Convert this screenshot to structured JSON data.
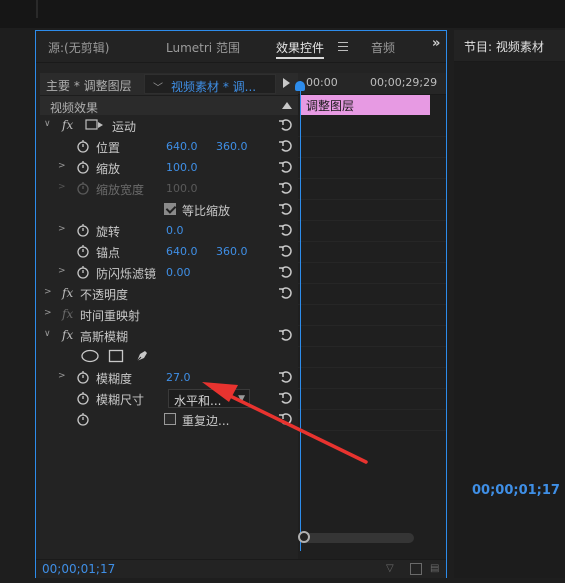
{
  "tabs": {
    "source": "源:(无剪辑)",
    "lumetri": "Lumetri 范围",
    "effect_controls": "效果控件",
    "audio": "音频",
    "program": "节目: 视频素材"
  },
  "header": {
    "master": "主要 * 调整图层",
    "clip_select": "视频素材 * 调...",
    "section": "视频效果"
  },
  "timeline": {
    "tc_start": "00:00",
    "tc_end": "00;00;29;29",
    "clip_label": "调整图层"
  },
  "effects": {
    "motion": {
      "name": "运动"
    },
    "position": {
      "name": "位置",
      "x": "640.0",
      "y": "360.0"
    },
    "scale": {
      "name": "缩放",
      "value": "100.0"
    },
    "scale_width": {
      "name": "缩放宽度",
      "value": "100.0"
    },
    "uniform_scale": {
      "name": "等比缩放"
    },
    "rotation": {
      "name": "旋转",
      "value": "0.0"
    },
    "anchor": {
      "name": "锚点",
      "x": "640.0",
      "y": "360.0"
    },
    "anti_flicker": {
      "name": "防闪烁滤镜",
      "value": "0.00"
    },
    "opacity": {
      "name": "不透明度"
    },
    "time_remap": {
      "name": "时间重映射"
    },
    "gaussian_blur": {
      "name": "高斯模糊"
    },
    "blurriness": {
      "name": "模糊度",
      "value": "27.0"
    },
    "blur_dimensions": {
      "name": "模糊尺寸",
      "value": "水平和..."
    },
    "repeat_edge": {
      "name": "重复边..."
    }
  },
  "footer": {
    "timecode": "00;00;01;17"
  },
  "program": {
    "timecode": "00;00;01;17"
  },
  "colors": {
    "accent": "#2d8ceb",
    "clip": "#e79ae3",
    "value": "#3f8fe6",
    "annotation": "#e8332f"
  }
}
